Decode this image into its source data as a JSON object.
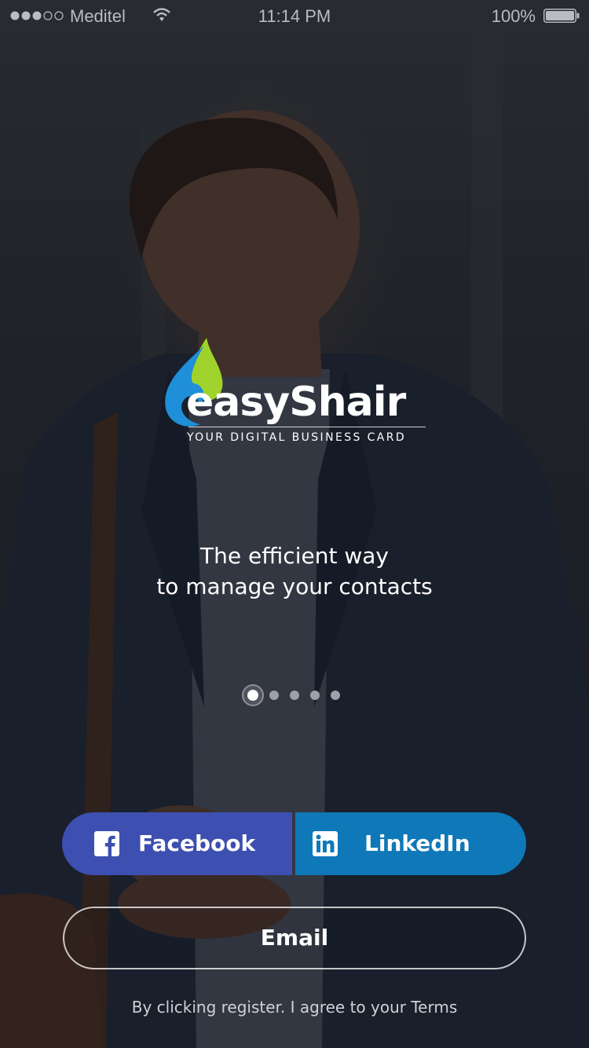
{
  "status_bar": {
    "carrier": "Meditel",
    "time": "11:14 PM",
    "battery": "100%",
    "signal_bars_filled": 3,
    "signal_bars_total": 5
  },
  "logo": {
    "name": "easyShair",
    "tagline": "YOUR DIGITAL BUSINESS CARD",
    "colors": {
      "drop_blue": "#1e8fd8",
      "drop_green": "#9fd22a"
    }
  },
  "headline": {
    "line1": "The efficient way",
    "line2": "to manage your contacts"
  },
  "pager": {
    "total": 5,
    "active_index": 0
  },
  "buttons": {
    "facebook": {
      "label": "Facebook",
      "icon": "facebook-icon",
      "color": "#3d4fb0"
    },
    "linkedin": {
      "label": "LinkedIn",
      "icon": "linkedin-icon",
      "color": "#0f78b8"
    },
    "email": {
      "label": "Email"
    }
  },
  "terms": "By clicking register. I agree to your Terms"
}
